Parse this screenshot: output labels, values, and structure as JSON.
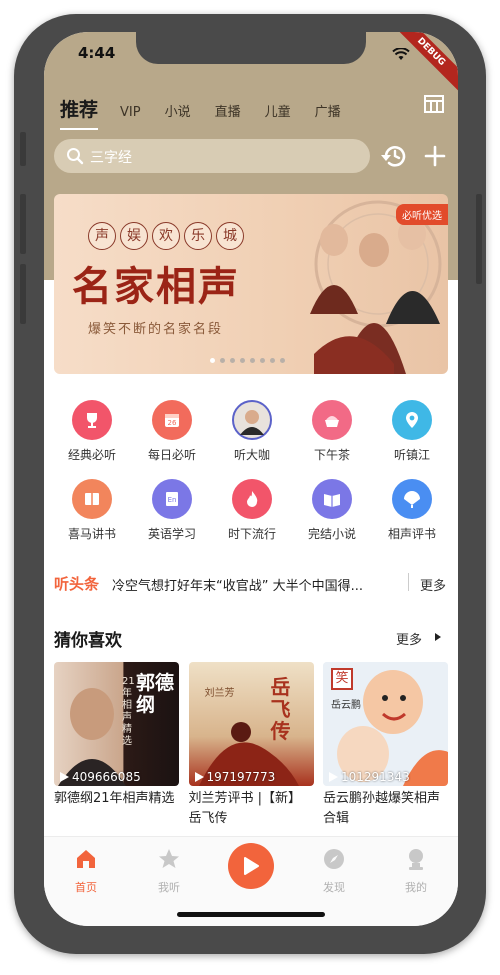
{
  "status": {
    "time": "4:44",
    "debug": "DEBUG"
  },
  "tabs": [
    "推荐",
    "VIP",
    "小说",
    "直播",
    "儿童",
    "广播"
  ],
  "search": {
    "placeholder": "三字经"
  },
  "banner": {
    "circle_chars": [
      "声",
      "娱",
      "欢",
      "乐",
      "城"
    ],
    "title": "名家相声",
    "subtitle": "爆笑不断的名家名段",
    "tag": "必听优选"
  },
  "grid": [
    [
      {
        "label": "经典必听",
        "icon": "trophy-icon",
        "color": "#f2556a"
      },
      {
        "label": "每日必听",
        "icon": "calendar-icon",
        "color": "#f26b5c"
      },
      {
        "label": "听大咖",
        "icon": "avatar-icon",
        "color": "#c9c0b8"
      },
      {
        "label": "下午茶",
        "icon": "cake-icon",
        "color": "#f26a86"
      },
      {
        "label": "听镇江",
        "icon": "location-icon",
        "color": "#3fb8e6"
      }
    ],
    [
      {
        "label": "喜马讲书",
        "icon": "book-icon",
        "color": "#f2855c"
      },
      {
        "label": "英语学习",
        "icon": "english-icon",
        "color": "#7b77e6"
      },
      {
        "label": "时下流行",
        "icon": "fire-icon",
        "color": "#f2556a"
      },
      {
        "label": "完结小说",
        "icon": "novel-icon",
        "color": "#7b77e6"
      },
      {
        "label": "相声评书",
        "icon": "fan-icon",
        "color": "#4a8ef2"
      }
    ]
  ],
  "news": {
    "tag": "听头条",
    "text": "冷空气想打好年末“收官战” 大半个中国得...",
    "more": "更多"
  },
  "section": {
    "title": "猜你喜欢",
    "more": "更多"
  },
  "cards": [
    {
      "plays": "409666085",
      "title": "郭德纲21年相声精选",
      "img_text": "郭德纲",
      "img_sub": "21年相声精选",
      "img_colors": [
        "#4a2a22",
        "#1e1414"
      ]
    },
    {
      "plays": "197197773",
      "title": "刘兰芳评书 |【新】岳飞传",
      "img_text": "岳飞传",
      "img_sub": "刘兰芳",
      "img_colors": [
        "#e8d6b8",
        "#a8321e"
      ]
    },
    {
      "plays": "101291343",
      "title": "岳云鹏孙越爆笑相声合辑",
      "img_text": "笑",
      "img_sub": "岳云鹏",
      "img_colors": [
        "#e6ecf2",
        "#f07a4a"
      ]
    }
  ],
  "tabbar": {
    "items": [
      {
        "label": "首页",
        "icon": "home-icon",
        "active": true
      },
      {
        "label": "我听",
        "icon": "star-icon",
        "active": false
      },
      {
        "label": "",
        "icon": "play-icon",
        "active": false
      },
      {
        "label": "发现",
        "icon": "compass-icon",
        "active": false
      },
      {
        "label": "我的",
        "icon": "profile-icon",
        "active": false
      }
    ]
  },
  "colors": {
    "accent": "#f2643c",
    "header_bg": "#b8a88a",
    "search_bg": "#d8ccb4"
  }
}
